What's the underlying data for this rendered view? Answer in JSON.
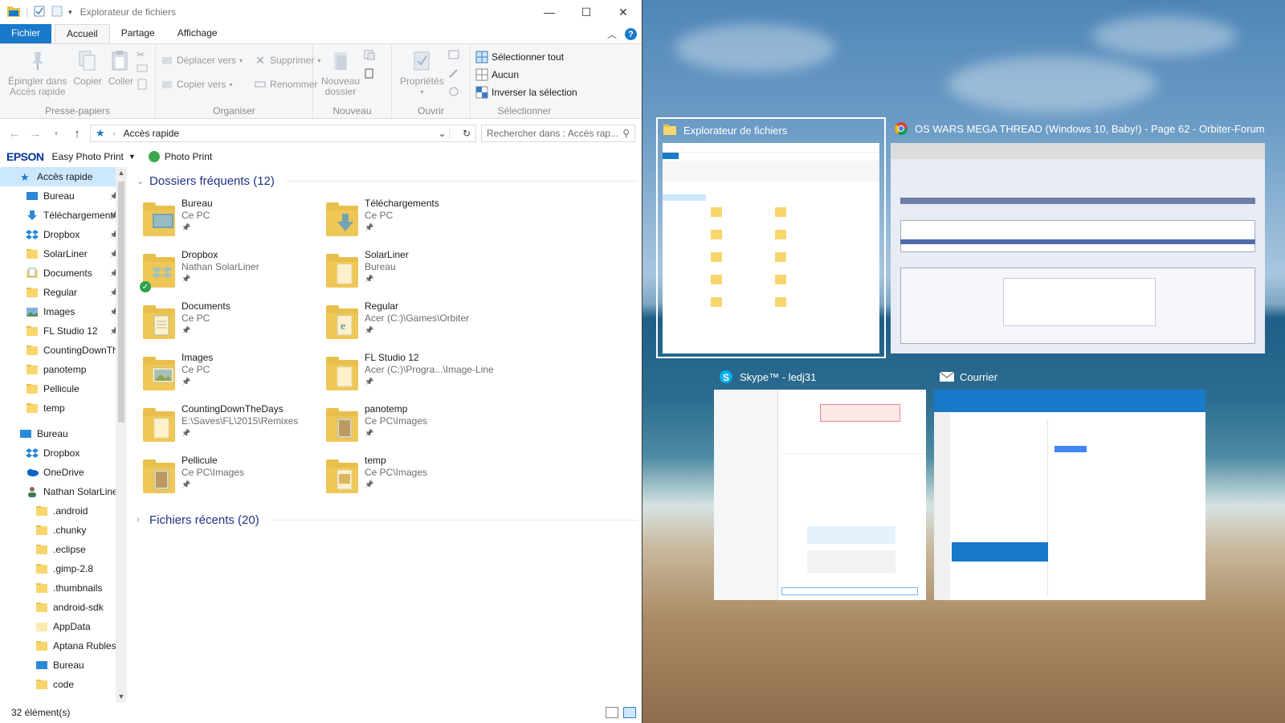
{
  "explorer": {
    "title": "Explorateur de fichiers",
    "tabs": {
      "file": "Fichier",
      "home": "Accueil",
      "share": "Partage",
      "view": "Affichage"
    },
    "ribbon": {
      "clipboard": {
        "pin": "Épingler dans Accès rapide",
        "pin_l1": "Épingler dans",
        "pin_l2": "Accès rapide",
        "copy": "Copier",
        "paste": "Coller",
        "group": "Presse-papiers"
      },
      "organize": {
        "move": "Déplacer vers",
        "copy_to": "Copier vers",
        "delete": "Supprimer",
        "rename": "Renommer",
        "group": "Organiser"
      },
      "new": {
        "new_folder_l1": "Nouveau",
        "new_folder_l2": "dossier",
        "group": "Nouveau"
      },
      "open": {
        "properties": "Propriétés",
        "group": "Ouvrir"
      },
      "select": {
        "all": "Sélectionner tout",
        "none": "Aucun",
        "invert": "Inverser la sélection",
        "group": "Sélectionner"
      }
    },
    "address": {
      "path": "Accès rapide",
      "search_placeholder": "Rechercher dans : Accès rap..."
    },
    "epson": {
      "logo": "EPSON",
      "easy_photo": "Easy Photo Print",
      "photo_print": "Photo Print"
    },
    "nav": [
      {
        "label": "Accès rapide",
        "icon": "star-icon",
        "indent": 1,
        "selected": true
      },
      {
        "label": "Bureau",
        "icon": "desktop-icon",
        "indent": 2,
        "pinned": true
      },
      {
        "label": "Téléchargements",
        "icon": "download-icon",
        "indent": 2,
        "pinned": true
      },
      {
        "label": "Dropbox",
        "icon": "dropbox-icon",
        "indent": 2,
        "pinned": true
      },
      {
        "label": "SolarLiner",
        "icon": "folder-icon",
        "indent": 2,
        "pinned": true
      },
      {
        "label": "Documents",
        "icon": "documents-icon",
        "indent": 2,
        "pinned": true
      },
      {
        "label": "Regular",
        "icon": "folder-icon",
        "indent": 2,
        "pinned": true
      },
      {
        "label": "Images",
        "icon": "images-icon",
        "indent": 2,
        "pinned": true
      },
      {
        "label": "FL Studio 12",
        "icon": "folder-icon",
        "indent": 2,
        "pinned": true
      },
      {
        "label": "CountingDownTheDays",
        "icon": "folder-icon",
        "indent": 2
      },
      {
        "label": "panotemp",
        "icon": "folder-icon",
        "indent": 2
      },
      {
        "label": "Pellicule",
        "icon": "folder-icon",
        "indent": 2
      },
      {
        "label": "temp",
        "icon": "folder-icon",
        "indent": 2
      },
      {
        "label": "",
        "icon": "",
        "indent": 0,
        "spacer": true
      },
      {
        "label": "Bureau",
        "icon": "desktop-icon",
        "indent": 1
      },
      {
        "label": "Dropbox",
        "icon": "dropbox-icon",
        "indent": 2
      },
      {
        "label": "OneDrive",
        "icon": "onedrive-icon",
        "indent": 2
      },
      {
        "label": "Nathan SolarLiner",
        "icon": "user-icon",
        "indent": 2
      },
      {
        "label": ".android",
        "icon": "folder-icon",
        "indent": 3
      },
      {
        "label": ".chunky",
        "icon": "folder-icon",
        "indent": 3
      },
      {
        "label": ".eclipse",
        "icon": "folder-icon",
        "indent": 3
      },
      {
        "label": ".gimp-2.8",
        "icon": "folder-icon",
        "indent": 3
      },
      {
        "label": ".thumbnails",
        "icon": "folder-icon",
        "indent": 3
      },
      {
        "label": "android-sdk",
        "icon": "folder-icon",
        "indent": 3
      },
      {
        "label": "AppData",
        "icon": "folder-light-icon",
        "indent": 3
      },
      {
        "label": "Aptana Rubles",
        "icon": "folder-icon",
        "indent": 3
      },
      {
        "label": "Bureau",
        "icon": "desktop-icon",
        "indent": 3
      },
      {
        "label": "code",
        "icon": "folder-icon",
        "indent": 3
      }
    ],
    "frequent": {
      "title": "Dossiers fréquents (12)"
    },
    "folders": [
      {
        "name": "Bureau",
        "sub": "Ce PC",
        "overlay": "desktop"
      },
      {
        "name": "Téléchargements",
        "sub": "Ce PC",
        "overlay": "download"
      },
      {
        "name": "Dropbox",
        "sub": "Nathan SolarLiner",
        "overlay": "dropbox"
      },
      {
        "name": "SolarLiner",
        "sub": "Bureau",
        "overlay": "plain"
      },
      {
        "name": "Documents",
        "sub": "Ce PC",
        "overlay": "document"
      },
      {
        "name": "Regular",
        "sub": "Acer (C:)\\Games\\Orbiter",
        "overlay": "ie"
      },
      {
        "name": "Images",
        "sub": "Ce PC",
        "overlay": "image"
      },
      {
        "name": "FL Studio 12",
        "sub": "Acer (C:)\\Progra...\\Image-Line",
        "overlay": "plain"
      },
      {
        "name": "CountingDownTheDays",
        "sub": "E:\\Saves\\FL\\2015\\Remixes",
        "overlay": "plain"
      },
      {
        "name": "panotemp",
        "sub": "Ce PC\\Images",
        "overlay": "image2"
      },
      {
        "name": "Pellicule",
        "sub": "Ce PC\\Images",
        "overlay": "image2"
      },
      {
        "name": "temp",
        "sub": "Ce PC\\Images",
        "overlay": "image3"
      }
    ],
    "recent": {
      "title": "Fichiers récents (20)"
    },
    "status": "32 élément(s)"
  },
  "taskview": {
    "windows": [
      {
        "title": "Explorateur de fichiers",
        "icon": "folder-icon",
        "selected": true
      },
      {
        "title": "OS WARS MEGA THREAD (Windows 10, Baby!) - Page 62 - Orbiter-Forum -...",
        "icon": "chrome-icon"
      },
      {
        "title": "Skype™ - ledj31",
        "icon": "skype-icon"
      },
      {
        "title": "Courrier",
        "icon": "mail-icon"
      }
    ]
  },
  "colors": {
    "accent": "#1979ca",
    "folder": "#f8d66d",
    "selection": "#cce8ff",
    "section": "#1e3287"
  }
}
